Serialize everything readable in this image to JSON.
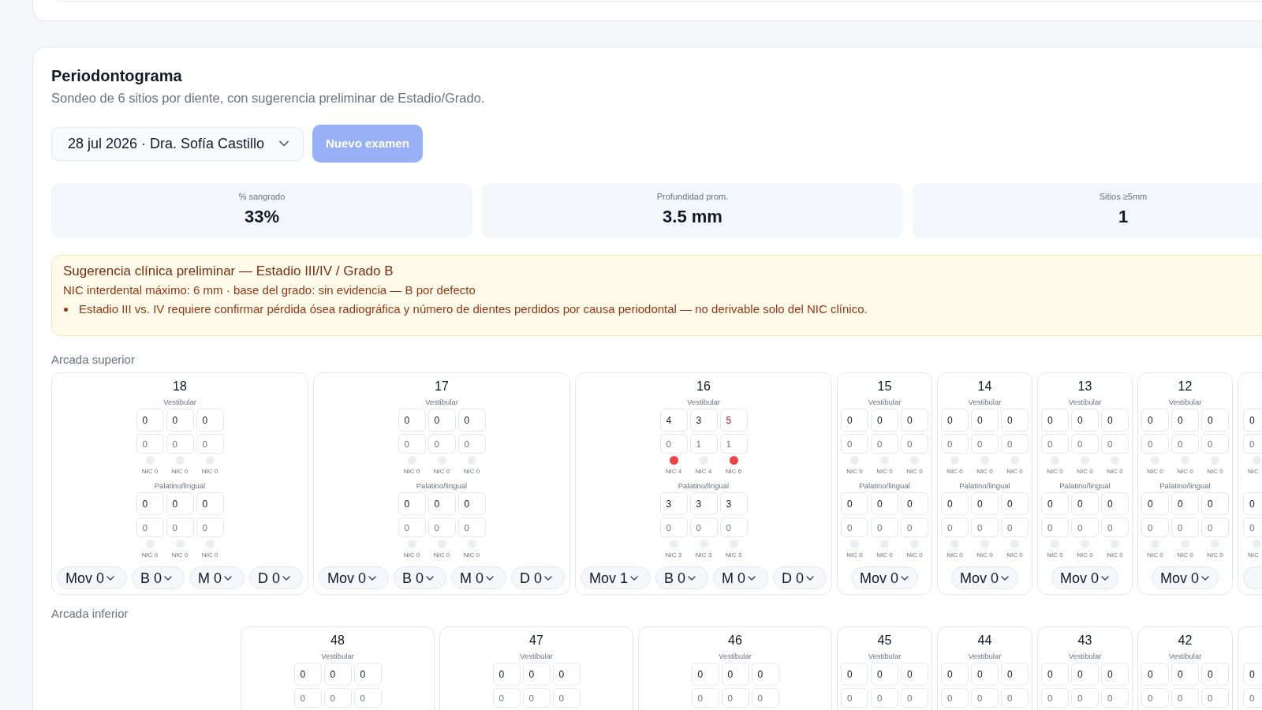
{
  "section": {
    "title": "Periodontograma",
    "subtitle": "Sondeo de 6 sitios por diente, con sugerencia preliminar de Estadio/Grado."
  },
  "exam_select": {
    "value": "28 jul 2026 · Dra. Sofía Castillo"
  },
  "new_exam_button": {
    "label": "Nuevo examen",
    "disabled": true
  },
  "stats": [
    {
      "label": "% sangrado",
      "value": "33%"
    },
    {
      "label": "Profundidad prom.",
      "value": "3.5 mm"
    },
    {
      "label": "Sitios ≥5mm",
      "value": "1"
    }
  ],
  "suggestion": {
    "title": "Sugerencia clínica preliminar — Estadio III/IV / Grado B",
    "detail": "NIC interdental máximo: 6 mm · base del grado: sin evidencia — B por defecto",
    "notes": [
      "Estadio III vs. IV requiere confirmar pérdida ósea radiográfica y número de dientes perdidos por causa periodontal — no derivable solo del NIC clínico."
    ]
  },
  "arches": [
    {
      "label": "Arcada superior",
      "teeth": [
        {
          "number": "18",
          "kind": "upper_molar",
          "surfaces": [
            {
              "label": "Vestibular",
              "sites": [
                {
                  "pd": "0",
                  "cal": "0",
                  "deep": false,
                  "bleeding": false,
                  "nic": "NIC 0"
                },
                {
                  "pd": "0",
                  "cal": "0",
                  "deep": false,
                  "bleeding": false,
                  "nic": "NIC 0"
                },
                {
                  "pd": "0",
                  "cal": "0",
                  "deep": false,
                  "bleeding": false,
                  "nic": "NIC 0"
                }
              ]
            },
            {
              "label": "Palatino/lingual",
              "sites": [
                {
                  "pd": "0",
                  "cal": "0",
                  "deep": false,
                  "bleeding": false,
                  "nic": "NIC 0"
                },
                {
                  "pd": "0",
                  "cal": "0",
                  "deep": false,
                  "bleeding": false,
                  "nic": "NIC 0"
                },
                {
                  "pd": "0",
                  "cal": "0",
                  "deep": false,
                  "bleeding": false,
                  "nic": "NIC 0"
                }
              ]
            }
          ],
          "selects": [
            "Mov 0",
            "B 0",
            "M 0",
            "D 0"
          ]
        },
        {
          "number": "17",
          "kind": "upper_molar",
          "surfaces": [
            {
              "label": "Vestibular",
              "sites": [
                {
                  "pd": "0",
                  "cal": "0",
                  "deep": false,
                  "bleeding": false,
                  "nic": "NIC 0"
                },
                {
                  "pd": "0",
                  "cal": "0",
                  "deep": false,
                  "bleeding": false,
                  "nic": "NIC 0"
                },
                {
                  "pd": "0",
                  "cal": "0",
                  "deep": false,
                  "bleeding": false,
                  "nic": "NIC 0"
                }
              ]
            },
            {
              "label": "Palatino/lingual",
              "sites": [
                {
                  "pd": "0",
                  "cal": "0",
                  "deep": false,
                  "bleeding": false,
                  "nic": "NIC 0"
                },
                {
                  "pd": "0",
                  "cal": "0",
                  "deep": false,
                  "bleeding": false,
                  "nic": "NIC 0"
                },
                {
                  "pd": "0",
                  "cal": "0",
                  "deep": false,
                  "bleeding": false,
                  "nic": "NIC 0"
                }
              ]
            }
          ],
          "selects": [
            "Mov 0",
            "B 0",
            "M 0",
            "D 0"
          ]
        },
        {
          "number": "16",
          "kind": "upper_molar",
          "surfaces": [
            {
              "label": "Vestibular",
              "sites": [
                {
                  "pd": "4",
                  "cal": "0",
                  "deep": false,
                  "bleeding": true,
                  "nic": "NIC 4"
                },
                {
                  "pd": "3",
                  "cal": "1",
                  "deep": false,
                  "bleeding": false,
                  "nic": "NIC 4"
                },
                {
                  "pd": "5",
                  "cal": "1",
                  "deep": true,
                  "bleeding": true,
                  "nic": "NIC 6"
                }
              ]
            },
            {
              "label": "Palatino/lingual",
              "sites": [
                {
                  "pd": "3",
                  "cal": "0",
                  "deep": false,
                  "bleeding": false,
                  "nic": "NIC 3"
                },
                {
                  "pd": "3",
                  "cal": "0",
                  "deep": false,
                  "bleeding": false,
                  "nic": "NIC 3"
                },
                {
                  "pd": "3",
                  "cal": "0",
                  "deep": false,
                  "bleeding": false,
                  "nic": "NIC 3"
                }
              ]
            }
          ],
          "selects": [
            "Mov 1",
            "B 0",
            "M 0",
            "D 0"
          ]
        },
        {
          "number": "15",
          "kind": "single",
          "surfaces": [
            {
              "label": "Vestibular",
              "sites": [
                {
                  "pd": "0",
                  "cal": "0",
                  "deep": false,
                  "bleeding": false,
                  "nic": "NIC 0"
                },
                {
                  "pd": "0",
                  "cal": "0",
                  "deep": false,
                  "bleeding": false,
                  "nic": "NIC 0"
                },
                {
                  "pd": "0",
                  "cal": "0",
                  "deep": false,
                  "bleeding": false,
                  "nic": "NIC 0"
                }
              ]
            },
            {
              "label": "Palatino/lingual",
              "sites": [
                {
                  "pd": "0",
                  "cal": "0",
                  "deep": false,
                  "bleeding": false,
                  "nic": "NIC 0"
                },
                {
                  "pd": "0",
                  "cal": "0",
                  "deep": false,
                  "bleeding": false,
                  "nic": "NIC 0"
                },
                {
                  "pd": "0",
                  "cal": "0",
                  "deep": false,
                  "bleeding": false,
                  "nic": "NIC 0"
                }
              ]
            }
          ],
          "selects": [
            "Mov 0"
          ]
        },
        {
          "number": "14",
          "kind": "single",
          "surfaces": [
            {
              "label": "Vestibular",
              "sites": [
                {
                  "pd": "0",
                  "cal": "0",
                  "deep": false,
                  "bleeding": false,
                  "nic": "NIC 0"
                },
                {
                  "pd": "0",
                  "cal": "0",
                  "deep": false,
                  "bleeding": false,
                  "nic": "NIC 0"
                },
                {
                  "pd": "0",
                  "cal": "0",
                  "deep": false,
                  "bleeding": false,
                  "nic": "NIC 0"
                }
              ]
            },
            {
              "label": "Palatino/lingual",
              "sites": [
                {
                  "pd": "0",
                  "cal": "0",
                  "deep": false,
                  "bleeding": false,
                  "nic": "NIC 0"
                },
                {
                  "pd": "0",
                  "cal": "0",
                  "deep": false,
                  "bleeding": false,
                  "nic": "NIC 0"
                },
                {
                  "pd": "0",
                  "cal": "0",
                  "deep": false,
                  "bleeding": false,
                  "nic": "NIC 0"
                }
              ]
            }
          ],
          "selects": [
            "Mov 0"
          ]
        },
        {
          "number": "13",
          "kind": "single",
          "surfaces": [
            {
              "label": "Vestibular",
              "sites": [
                {
                  "pd": "0",
                  "cal": "0",
                  "deep": false,
                  "bleeding": false,
                  "nic": "NIC 0"
                },
                {
                  "pd": "0",
                  "cal": "0",
                  "deep": false,
                  "bleeding": false,
                  "nic": "NIC 0"
                },
                {
                  "pd": "0",
                  "cal": "0",
                  "deep": false,
                  "bleeding": false,
                  "nic": "NIC 0"
                }
              ]
            },
            {
              "label": "Palatino/lingual",
              "sites": [
                {
                  "pd": "0",
                  "cal": "0",
                  "deep": false,
                  "bleeding": false,
                  "nic": "NIC 0"
                },
                {
                  "pd": "0",
                  "cal": "0",
                  "deep": false,
                  "bleeding": false,
                  "nic": "NIC 0"
                },
                {
                  "pd": "0",
                  "cal": "0",
                  "deep": false,
                  "bleeding": false,
                  "nic": "NIC 0"
                }
              ]
            }
          ],
          "selects": [
            "Mov 0"
          ]
        },
        {
          "number": "12",
          "kind": "single",
          "surfaces": [
            {
              "label": "Vestibular",
              "sites": [
                {
                  "pd": "0",
                  "cal": "0",
                  "deep": false,
                  "bleeding": false,
                  "nic": "NIC 0"
                },
                {
                  "pd": "0",
                  "cal": "0",
                  "deep": false,
                  "bleeding": false,
                  "nic": "NIC 0"
                },
                {
                  "pd": "0",
                  "cal": "0",
                  "deep": false,
                  "bleeding": false,
                  "nic": "NIC 0"
                }
              ]
            },
            {
              "label": "Palatino/lingual",
              "sites": [
                {
                  "pd": "0",
                  "cal": "0",
                  "deep": false,
                  "bleeding": false,
                  "nic": "NIC 0"
                },
                {
                  "pd": "0",
                  "cal": "0",
                  "deep": false,
                  "bleeding": false,
                  "nic": "NIC 0"
                },
                {
                  "pd": "0",
                  "cal": "0",
                  "deep": false,
                  "bleeding": false,
                  "nic": "NIC 0"
                }
              ]
            }
          ],
          "selects": [
            "Mov 0"
          ]
        },
        {
          "kind": "cut",
          "surfaces": [
            {
              "sites": [
                {
                  "pd": "0",
                  "cal": "0",
                  "deep": false,
                  "bleeding": false,
                  "nic": "NIC"
                }
              ]
            },
            {
              "sites": [
                {
                  "pd": "0",
                  "cal": "0",
                  "deep": false,
                  "bleeding": false,
                  "nic": "NIC"
                }
              ]
            }
          ]
        }
      ]
    },
    {
      "label": "Arcada inferior",
      "teeth": [
        {
          "number": "48",
          "kind": "lower_molar",
          "surfaces": [
            {
              "label": "Vestibular",
              "sites": [
                {
                  "pd": "0",
                  "cal": "0",
                  "deep": false
                },
                {
                  "pd": "0",
                  "cal": "0",
                  "deep": false
                },
                {
                  "pd": "0",
                  "cal": "0",
                  "deep": false
                }
              ]
            }
          ]
        },
        {
          "number": "47",
          "kind": "lower_molar",
          "surfaces": [
            {
              "label": "Vestibular",
              "sites": [
                {
                  "pd": "0",
                  "cal": "0",
                  "deep": false
                },
                {
                  "pd": "0",
                  "cal": "0",
                  "deep": false
                },
                {
                  "pd": "0",
                  "cal": "0",
                  "deep": false
                }
              ]
            }
          ]
        },
        {
          "number": "46",
          "kind": "lower_molar",
          "surfaces": [
            {
              "label": "Vestibular",
              "sites": [
                {
                  "pd": "0",
                  "cal": "0",
                  "deep": false
                },
                {
                  "pd": "0",
                  "cal": "0",
                  "deep": false
                },
                {
                  "pd": "0",
                  "cal": "0",
                  "deep": false
                }
              ]
            }
          ]
        },
        {
          "number": "45",
          "kind": "single",
          "surfaces": [
            {
              "label": "Vestibular",
              "sites": [
                {
                  "pd": "0",
                  "cal": "0",
                  "deep": false
                },
                {
                  "pd": "0",
                  "cal": "0",
                  "deep": false
                },
                {
                  "pd": "0",
                  "cal": "0",
                  "deep": false
                }
              ]
            }
          ]
        },
        {
          "number": "44",
          "kind": "single",
          "surfaces": [
            {
              "label": "Vestibular",
              "sites": [
                {
                  "pd": "0",
                  "cal": "0",
                  "deep": false
                },
                {
                  "pd": "0",
                  "cal": "0",
                  "deep": false
                },
                {
                  "pd": "0",
                  "cal": "0",
                  "deep": false
                }
              ]
            }
          ]
        },
        {
          "number": "43",
          "kind": "single",
          "surfaces": [
            {
              "label": "Vestibular",
              "sites": [
                {
                  "pd": "0",
                  "cal": "0",
                  "deep": false
                },
                {
                  "pd": "0",
                  "cal": "0",
                  "deep": false
                },
                {
                  "pd": "0",
                  "cal": "0",
                  "deep": false
                }
              ]
            }
          ]
        },
        {
          "number": "42",
          "kind": "single",
          "surfaces": [
            {
              "label": "Vestibular",
              "sites": [
                {
                  "pd": "0",
                  "cal": "0",
                  "deep": false
                },
                {
                  "pd": "0",
                  "cal": "0",
                  "deep": false
                },
                {
                  "pd": "0",
                  "cal": "0",
                  "deep": false
                }
              ]
            }
          ]
        },
        {
          "kind": "cut",
          "surfaces": [
            {
              "sites": [
                {
                  "pd": "0",
                  "cal": "0",
                  "deep": false
                }
              ]
            }
          ]
        }
      ]
    }
  ]
}
